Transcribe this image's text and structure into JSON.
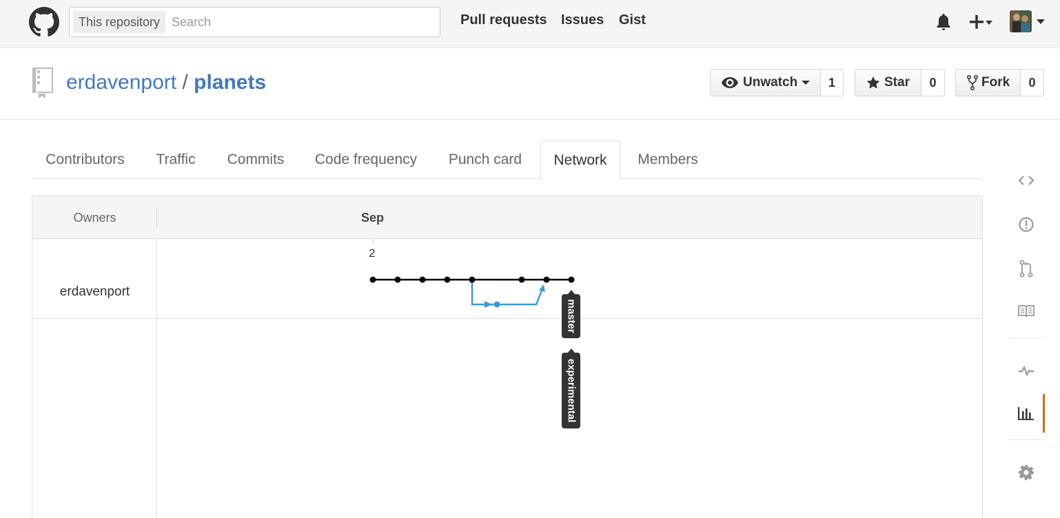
{
  "header": {
    "search_scope": "This repository",
    "search_placeholder": "Search",
    "nav": [
      "Pull requests",
      "Issues",
      "Gist"
    ],
    "icons": [
      "github-logo",
      "bell-icon",
      "plus-icon",
      "avatar"
    ]
  },
  "repo": {
    "owner": "erdavenport",
    "separator": "/",
    "name": "planets",
    "watch_label": "Unwatch",
    "watch_count": "1",
    "star_label": "Star",
    "star_count": "0",
    "fork_label": "Fork",
    "fork_count": "0"
  },
  "tabs": [
    {
      "label": "Contributors",
      "active": false
    },
    {
      "label": "Traffic",
      "active": false
    },
    {
      "label": "Commits",
      "active": false
    },
    {
      "label": "Code frequency",
      "active": false
    },
    {
      "label": "Punch card",
      "active": false
    },
    {
      "label": "Network",
      "active": true
    },
    {
      "label": "Members",
      "active": false
    }
  ],
  "network": {
    "owners_header": "Owners",
    "month": "Sep",
    "day": "2",
    "owners": [
      "erdavenport"
    ],
    "branches": [
      {
        "name": "master",
        "commits": 8,
        "color": "#000000"
      },
      {
        "name": "experimental",
        "commits": 1,
        "color": "#3a9bdc"
      }
    ]
  },
  "sidebar": {
    "items": [
      "code-icon",
      "issues-icon",
      "pull-request-icon",
      "wiki-icon",
      "pulse-icon",
      "graphs-icon",
      "settings-icon"
    ],
    "selected": "graphs-icon",
    "accent": "#d26911"
  }
}
